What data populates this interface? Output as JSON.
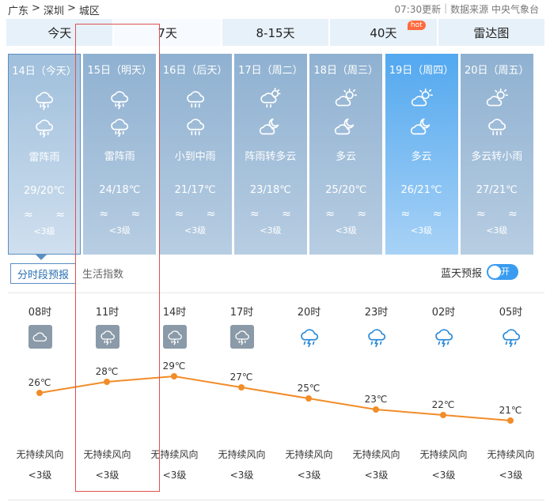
{
  "breadcrumb": [
    "广东",
    ">",
    "深圳",
    ">",
    "城区"
  ],
  "meta": {
    "update": "07:30更新",
    "source": "数据来源 中央气象台"
  },
  "tabs": [
    {
      "label": "今天"
    },
    {
      "label": "7天"
    },
    {
      "label": "8-15天"
    },
    {
      "label": "40天",
      "badge": "hot"
    },
    {
      "label": "雷达图"
    }
  ],
  "days": [
    {
      "date": "14日（今天）",
      "cond": "雷阵雨",
      "temp": "29/20℃",
      "waves": "≈ ≈",
      "level": "<3级",
      "icon1": "thunder-rain",
      "icon2": "thunder-rain"
    },
    {
      "date": "15日（明天）",
      "cond": "雷阵雨",
      "temp": "24/18℃",
      "waves": "≈ ≈",
      "level": "<3级",
      "icon1": "thunder-rain",
      "icon2": "thunder-rain"
    },
    {
      "date": "16日（后天）",
      "cond": "小到中雨",
      "temp": "21/17℃",
      "waves": "≈ ≈",
      "level": "<3级",
      "icon1": "rain",
      "icon2": "rain"
    },
    {
      "date": "17日（周二）",
      "cond": "阵雨转多云",
      "temp": "23/18℃",
      "waves": "≈ ≈",
      "level": "<3级",
      "icon1": "shower",
      "icon2": "cloudy-night"
    },
    {
      "date": "18日（周三）",
      "cond": "多云",
      "temp": "25/20℃",
      "waves": "≈ ≈",
      "level": "<3级",
      "icon1": "partly-cloudy",
      "icon2": "cloudy-night"
    },
    {
      "date": "19日（周四）",
      "cond": "多云",
      "temp": "26/21℃",
      "waves": "≈ ≈",
      "level": "<3级",
      "icon1": "partly-cloudy",
      "icon2": "cloudy-night"
    },
    {
      "date": "20日（周五）",
      "cond": "多云转小雨",
      "temp": "27/21℃",
      "waves": "≈ ≈",
      "level": "<3级",
      "icon1": "partly-cloudy",
      "icon2": "rain"
    }
  ],
  "subtabs": [
    {
      "label": "分时段预报"
    },
    {
      "label": "生活指数"
    }
  ],
  "bluesky": {
    "label": "蓝天预报",
    "toggle": "开"
  },
  "hourly": [
    {
      "time": "08时",
      "temp": 26,
      "temp_label": "26℃",
      "wind": "无持续风向",
      "level": "<3级",
      "icon": "cloudy"
    },
    {
      "time": "11时",
      "temp": 28,
      "temp_label": "28℃",
      "wind": "无持续风向",
      "level": "<3级",
      "icon": "thunder-rain"
    },
    {
      "time": "14时",
      "temp": 29,
      "temp_label": "29℃",
      "wind": "无持续风向",
      "level": "<3级",
      "icon": "thunder-rain"
    },
    {
      "time": "17时",
      "temp": 27,
      "temp_label": "27℃",
      "wind": "无持续风向",
      "level": "<3级",
      "icon": "thunder-rain"
    },
    {
      "time": "20时",
      "temp": 25,
      "temp_label": "25℃",
      "wind": "无持续风向",
      "level": "<3级",
      "icon": "thunder-rain-outline"
    },
    {
      "time": "23时",
      "temp": 23,
      "temp_label": "23℃",
      "wind": "无持续风向",
      "level": "<3级",
      "icon": "thunder-rain-outline"
    },
    {
      "time": "02时",
      "temp": 22,
      "temp_label": "22℃",
      "wind": "无持续风向",
      "level": "<3级",
      "icon": "thunder-rain-outline"
    },
    {
      "time": "05时",
      "temp": 21,
      "temp_label": "21℃",
      "wind": "无持续风向",
      "level": "<3级",
      "icon": "thunder-rain-outline"
    }
  ],
  "colors": {
    "line": "#f28c28",
    "sunny_card": "#52a8ef",
    "card": "#8fb1d1",
    "accent": "#3a9cf0",
    "highlight": "#e05050"
  }
}
